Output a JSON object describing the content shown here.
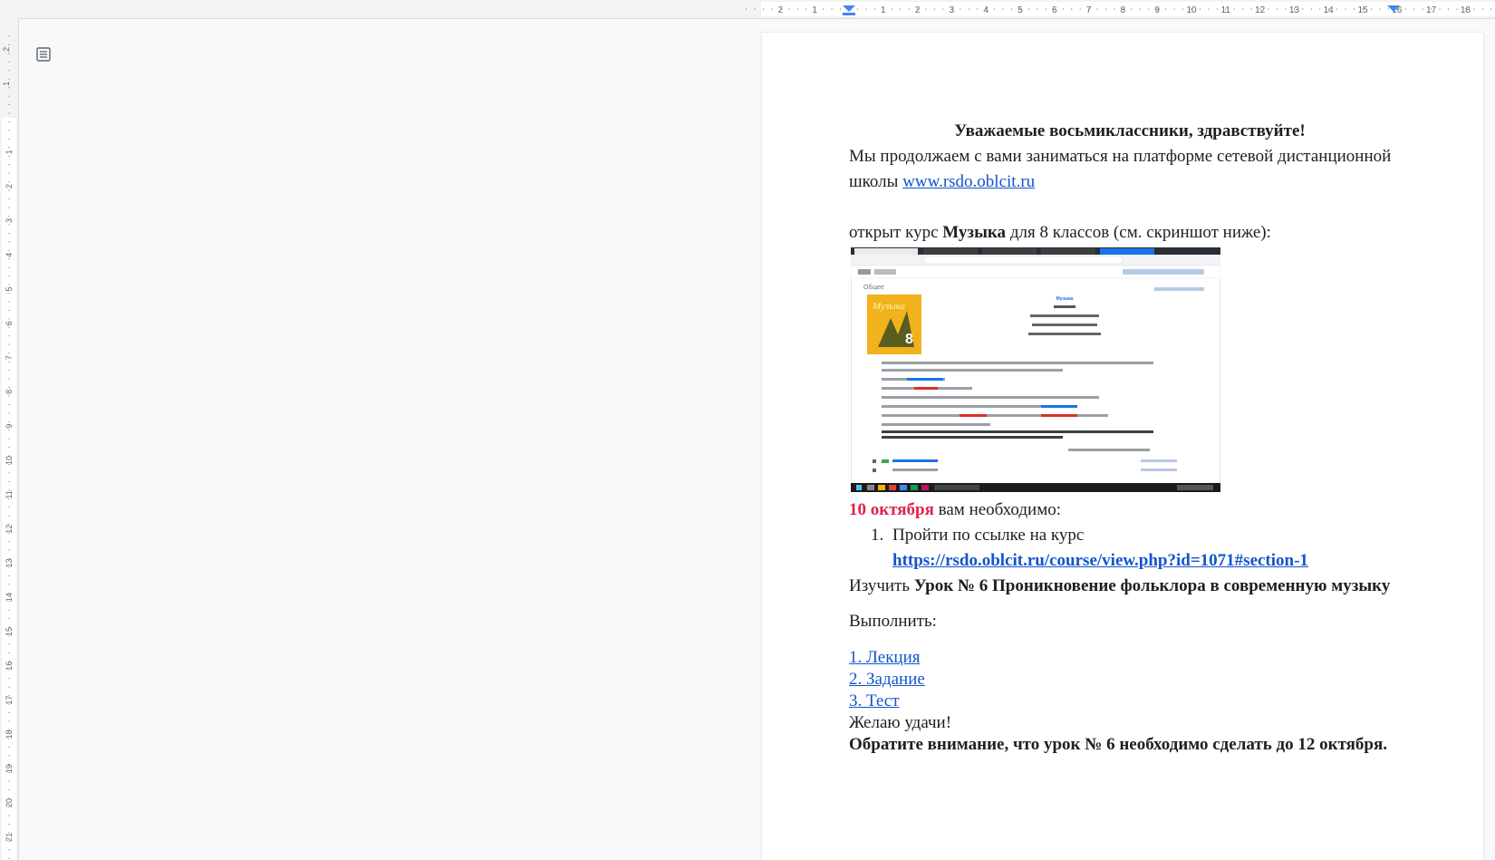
{
  "ruler": {
    "h_neg_labels": [
      "2",
      "1"
    ],
    "h_pos_labels": [
      "1",
      "2",
      "3",
      "4",
      "5",
      "6",
      "7",
      "8",
      "9",
      "10",
      "11",
      "12",
      "13",
      "14",
      "15",
      "16",
      "17",
      "18"
    ],
    "v_neg_labels": [
      "2",
      "1"
    ],
    "v_pos_labels": [
      "1",
      "2",
      "3",
      "4",
      "5",
      "6",
      "7",
      "8",
      "9",
      "10",
      "11",
      "12",
      "13",
      "14",
      "15",
      "16",
      "17",
      "18",
      "19",
      "20",
      "21"
    ]
  },
  "doc": {
    "greeting": "Уважаемые восьмиклассники, здравствуйте!",
    "intro": "Мы продолжаем с вами заниматься на платформе сетевой дистанционной школы ",
    "site_link": "www.rsdo.oblcit.ru",
    "course_pre": "открыт курс ",
    "course_name": "Музыка",
    "course_post": " для 8 классов (см. скриншот ниже):",
    "date_red": "10 октября",
    "date_post": " вам необходимо:",
    "item1_num": "1.",
    "item1_text": "Пройти по ссылке на курс",
    "course_link": "https://rsdo.oblcit.ru/course/view.php?id=1071#section-1",
    "study_pre": "Изучить ",
    "lesson_title": "Урок № 6 Проникновение фольклора в современную музыку",
    "do_label": "Выполнить:",
    "task_links": [
      "1. Лекция",
      "2. Задание",
      "3. Тест"
    ],
    "good_luck": "Желаю удачи!",
    "notice": "Обратите внимание, что урок № 6 необходимо сделать до 12 октября."
  },
  "screenshot": {
    "heading": "Общее",
    "book_label": "Музыка",
    "book_number": "8",
    "course_title": "Музыка"
  },
  "colors": {
    "link": "#1155cc",
    "accent_red": "#e0224f",
    "ruler_marker": "#4285f4"
  },
  "icons": {
    "outline": "document-outline-icon"
  }
}
